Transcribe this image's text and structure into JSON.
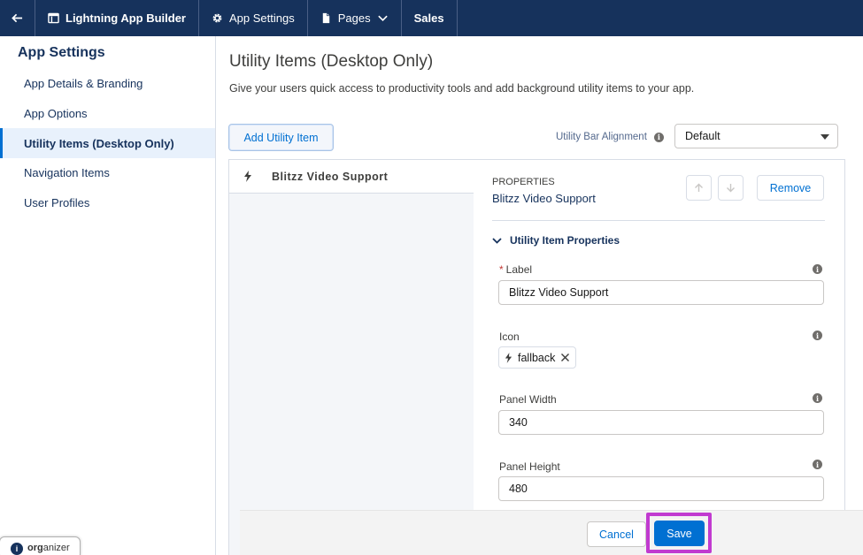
{
  "topbar": {
    "back_icon": "arrow-left-icon",
    "builder_title": "Lightning App Builder",
    "app_settings": "App Settings",
    "pages": "Pages",
    "app_name": "Sales"
  },
  "sidebar": {
    "title": "App Settings",
    "items": [
      {
        "label": "App Details & Branding"
      },
      {
        "label": "App Options"
      },
      {
        "label": "Utility Items (Desktop Only)"
      },
      {
        "label": "Navigation Items"
      },
      {
        "label": "User Profiles"
      }
    ]
  },
  "main": {
    "title": "Utility Items (Desktop Only)",
    "description": "Give your users quick access to productivity tools and add background utility items to your app.",
    "add_button": "Add Utility Item",
    "alignment_label": "Utility Bar Alignment",
    "alignment_value": "Default",
    "utility_items": [
      {
        "label": "Blitzz Video Support",
        "icon": "lightning-bolt-icon"
      }
    ]
  },
  "properties": {
    "heading": "PROPERTIES",
    "item_name": "Blitzz Video Support",
    "remove_button": "Remove",
    "section_title": "Utility Item Properties",
    "fields": {
      "label": {
        "label": "Label",
        "required_mark": "*",
        "value": "Blitzz Video Support"
      },
      "icon": {
        "label": "Icon",
        "value": "fallback"
      },
      "panel_width": {
        "label": "Panel Width",
        "value": "340"
      },
      "panel_height": {
        "label": "Panel Height",
        "value": "480"
      }
    }
  },
  "footer": {
    "cancel": "Cancel",
    "save": "Save",
    "highlight_color": "#c13ad0"
  },
  "organizer": {
    "prefix": "org",
    "suffix": "anizer"
  }
}
